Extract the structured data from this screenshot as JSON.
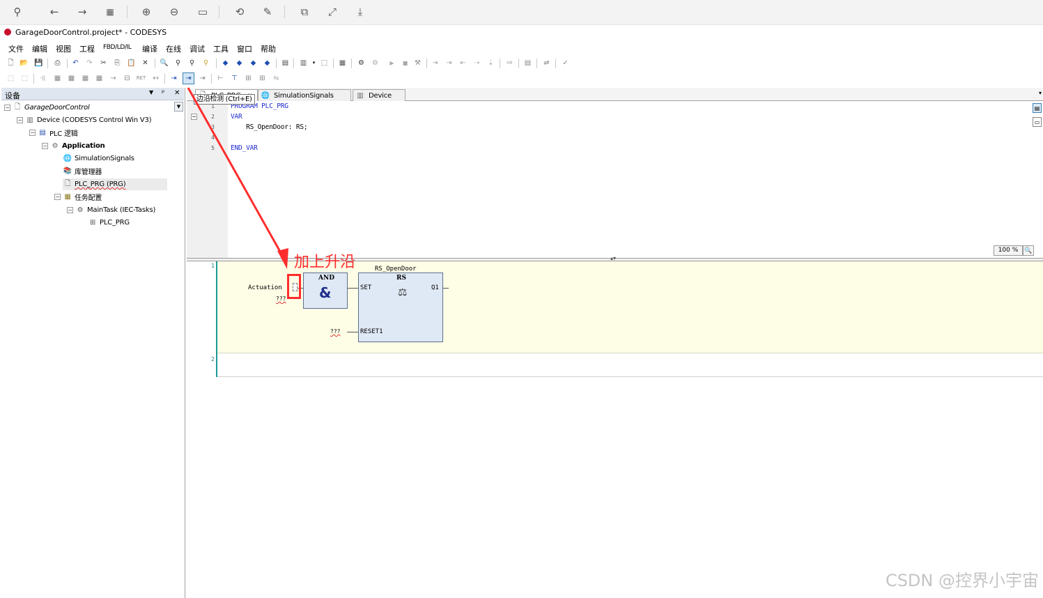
{
  "window": {
    "title": "GarageDoorControl.project* - CODESYS"
  },
  "viewer_toolbar": {
    "icons": [
      "pin-icon",
      "back-icon",
      "forward-icon",
      "grid-icon",
      "zoom-in-icon",
      "zoom-out-icon",
      "fit-icon",
      "rotate-icon",
      "edit-icon",
      "window-icon",
      "fullscreen-icon",
      "download-icon"
    ]
  },
  "menu": {
    "items": [
      "文件",
      "编辑",
      "视图",
      "工程",
      "FBD/LD/IL",
      "编译",
      "在线",
      "调试",
      "工具",
      "窗口",
      "帮助"
    ]
  },
  "tooltip": {
    "text": "边沿检测 (Ctrl+E)"
  },
  "devices_panel": {
    "title": "设备",
    "pin_glyph": "ᵖ",
    "close_glyph": "✕",
    "tree": [
      {
        "label": "GarageDoorControl",
        "style": "italic"
      },
      {
        "label": "Device (CODESYS Control Win V3)",
        "style": "normal"
      },
      {
        "label": "PLC 逻辑",
        "style": "normal"
      },
      {
        "label": "Application",
        "style": "bold"
      },
      {
        "label": "SimulationSignals",
        "style": "normal"
      },
      {
        "label": "库管理器",
        "style": "normal"
      },
      {
        "label": "PLC_PRG (PRG)",
        "style": "selected"
      },
      {
        "label": "任务配置",
        "style": "normal"
      },
      {
        "label": "MainTask (IEC-Tasks)",
        "style": "normal"
      },
      {
        "label": "PLC_PRG",
        "style": "normal"
      }
    ]
  },
  "editor": {
    "tabs": [
      {
        "label": "PLC_PRG",
        "suffix": "x"
      },
      {
        "label": "SimulationSignals",
        "suffix": ""
      },
      {
        "label": "Device",
        "suffix": ""
      }
    ],
    "declaration": {
      "line_numbers": [
        "1",
        "2",
        "3",
        "4",
        "5"
      ],
      "lines": [
        "PROGRAM PLC_PRG",
        "VAR",
        "    RS_OpenDoor: RS;",
        "",
        "END_VAR"
      ]
    },
    "zoom": "100 %",
    "fbd": {
      "networks": [
        "1",
        "2"
      ],
      "instance_name": "RS_OpenDoor",
      "and_block": {
        "name": "AND",
        "symbol": "&"
      },
      "rs_block": {
        "name": "RS",
        "inputs": [
          "SET",
          "RESET1"
        ],
        "output": "Q1"
      },
      "input_var": "Actuation",
      "placeholder_1": "???",
      "placeholder_2": "???"
    }
  },
  "annotation": {
    "text": "加上升沿",
    "color": "#ff2d2d"
  },
  "watermark": "CSDN @控界小宇宙"
}
